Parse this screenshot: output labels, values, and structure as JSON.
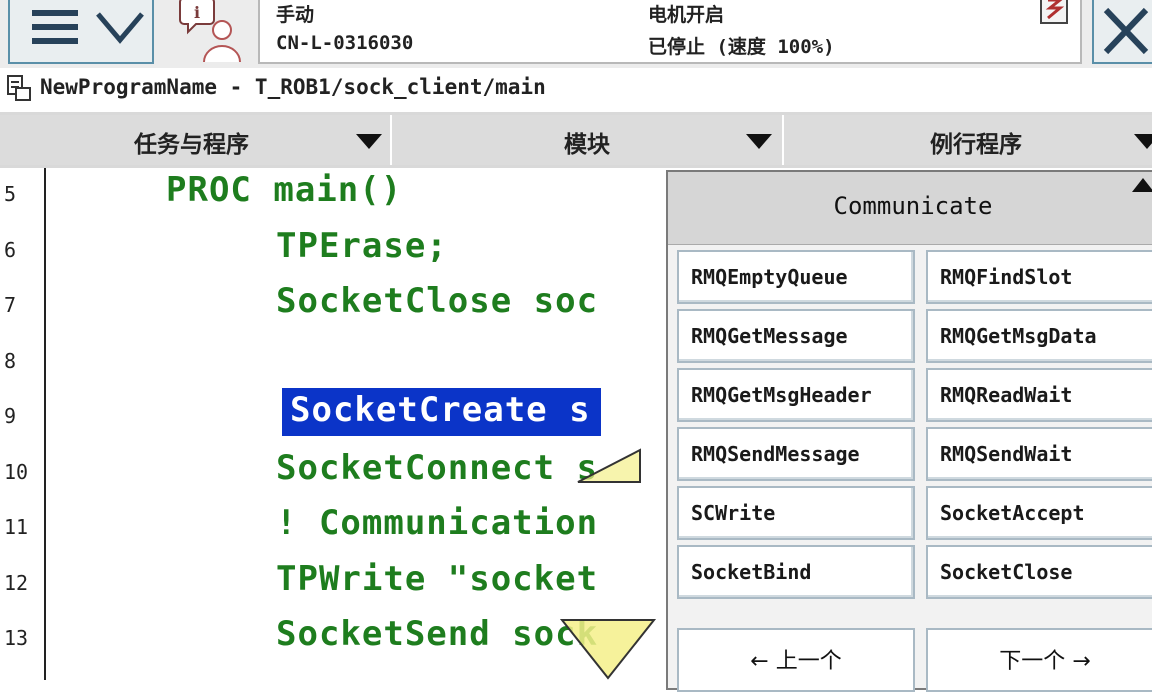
{
  "status": {
    "mode": "手动",
    "controller_id": "CN-L-0316030",
    "motor_state": "电机开启",
    "run_state": "已停止 (速度 100%)"
  },
  "path": {
    "program_path": "NewProgramName - T_ROB1/sock_client/main"
  },
  "tabs": [
    {
      "label": "任务与程序"
    },
    {
      "label": "模块"
    },
    {
      "label": "例行程序"
    }
  ],
  "code": {
    "line_numbers": [
      "5",
      "6",
      "7",
      "8",
      "9",
      "10",
      "11",
      "12",
      "13"
    ],
    "lines": [
      "PROC main()",
      "TPErase;",
      "SocketClose soc",
      "",
      "SocketCreate s",
      "SocketConnect s",
      "! Communication",
      "TPWrite \"socket",
      "SocketSend sock"
    ],
    "selected_index": 4
  },
  "picklist": {
    "title": "Communicate",
    "items": [
      "RMQEmptyQueue",
      "RMQFindSlot",
      "RMQGetMessage",
      "RMQGetMsgData",
      "RMQGetMsgHeader",
      "RMQReadWait",
      "RMQSendMessage",
      "RMQSendWait",
      "SCWrite",
      "SocketAccept",
      "SocketBind",
      "SocketClose"
    ],
    "prev_label": "← 上一个",
    "next_label": "下一个 →"
  },
  "colors": {
    "code_green": "#1e7d1e",
    "selection_blue": "#0b34c8",
    "button_border": "#5a8fa8"
  }
}
